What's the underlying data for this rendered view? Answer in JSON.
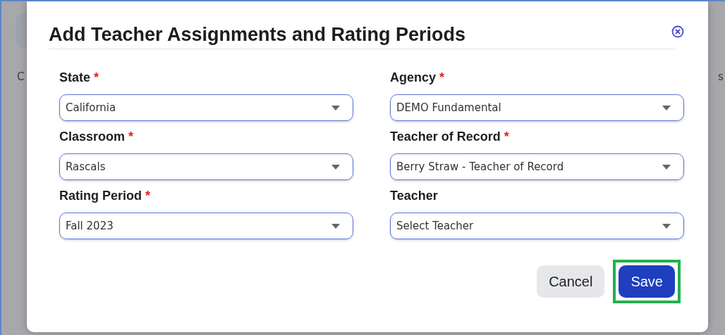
{
  "background": {
    "left_text": "C",
    "right_text": "s"
  },
  "dialog": {
    "title": "Add Teacher Assignments and Rating Periods",
    "fields": [
      {
        "label": "State",
        "required": true,
        "value": "California"
      },
      {
        "label": "Agency",
        "required": true,
        "value": "DEMO Fundamental"
      },
      {
        "label": "Classroom",
        "required": true,
        "value": "Rascals"
      },
      {
        "label": "Teacher of Record",
        "required": true,
        "value": "Berry Straw - Teacher of Record"
      },
      {
        "label": "Rating Period",
        "required": true,
        "value": "Fall 2023"
      },
      {
        "label": "Teacher",
        "required": false,
        "value": "Select Teacher"
      }
    ],
    "required_mark": "*",
    "buttons": [
      {
        "label": "Cancel",
        "kind": "secondary",
        "highlighted": false
      },
      {
        "label": "Save",
        "kind": "primary",
        "highlighted": true
      }
    ]
  }
}
